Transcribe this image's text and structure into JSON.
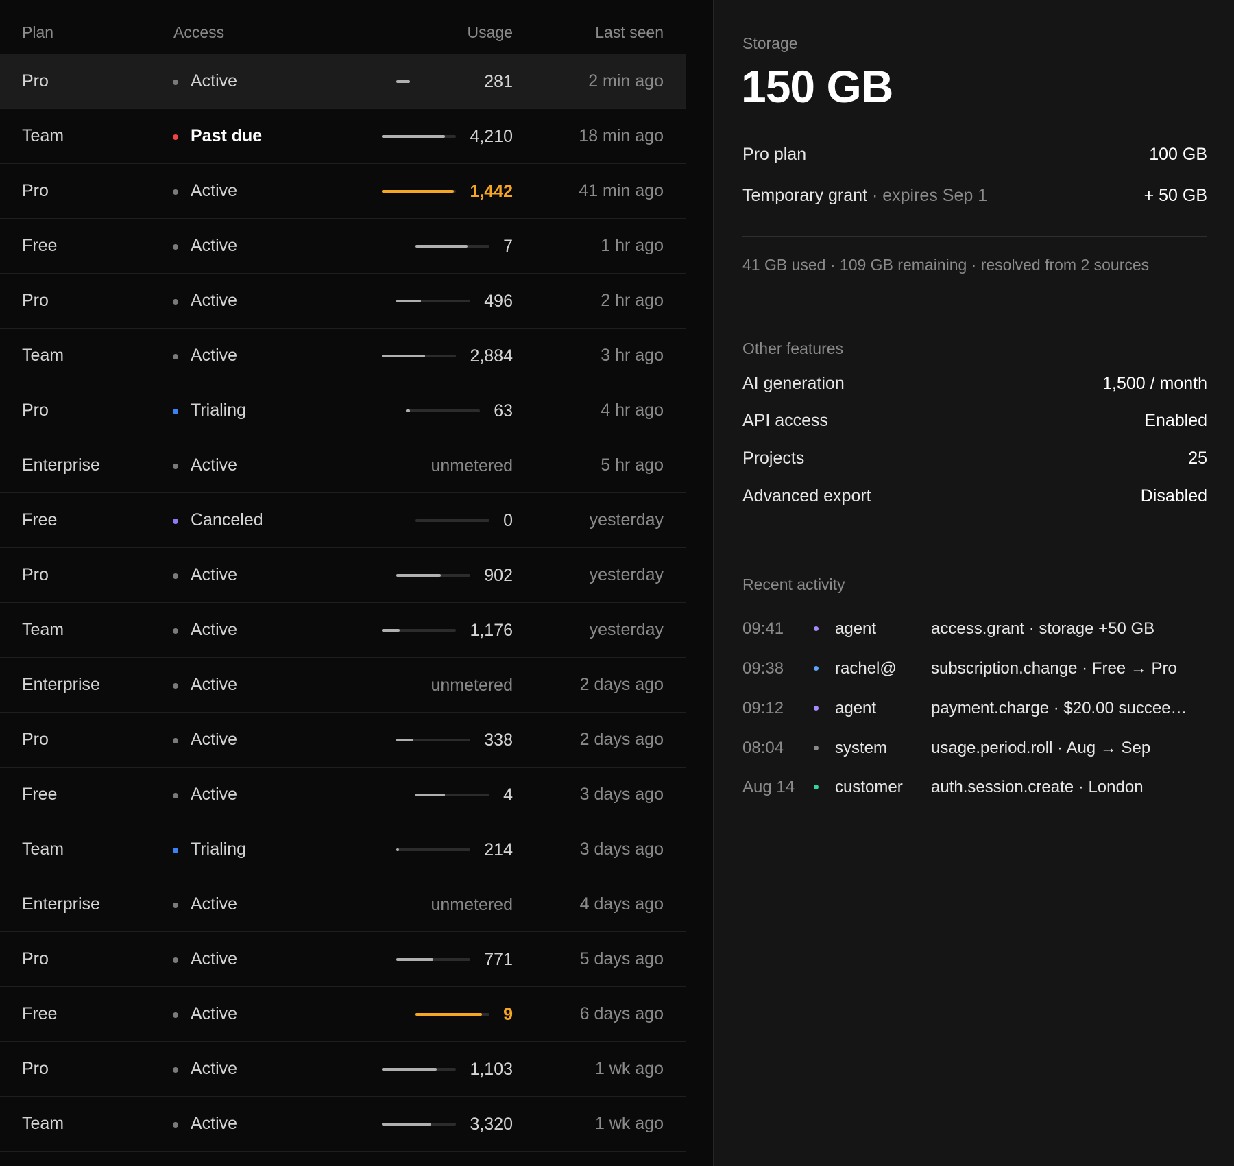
{
  "colors": {
    "active": "#7a7a7a",
    "past_due": "#ef4444",
    "trialing": "#3b82f6",
    "canceled": "#8b7cf6",
    "warn": "#f5a623",
    "agent": "#a78bfa",
    "user": "#60a5fa",
    "system": "#8a8a8a",
    "customer": "#34d399"
  },
  "table": {
    "headers": {
      "plan": "Plan",
      "access": "Access",
      "usage": "Usage",
      "last_seen": "Last seen"
    },
    "rows": [
      {
        "plan": "Pro",
        "access": "Active",
        "status": "active",
        "usage": "281",
        "fill": 0.0,
        "warn": false,
        "last_seen": "2 min ago",
        "selected": true
      },
      {
        "plan": "Team",
        "access": "Past due",
        "status": "past_due",
        "usage": "4,210",
        "fill": 0.85,
        "warn": false,
        "last_seen": "18 min ago"
      },
      {
        "plan": "Pro",
        "access": "Active",
        "status": "active",
        "usage": "1,442",
        "fill": 0.97,
        "warn": true,
        "last_seen": "41 min ago"
      },
      {
        "plan": "Free",
        "access": "Active",
        "status": "active",
        "usage": "7",
        "fill": 0.7,
        "warn": false,
        "last_seen": "1 hr ago"
      },
      {
        "plan": "Pro",
        "access": "Active",
        "status": "active",
        "usage": "496",
        "fill": 0.33,
        "warn": false,
        "last_seen": "2 hr ago"
      },
      {
        "plan": "Team",
        "access": "Active",
        "status": "active",
        "usage": "2,884",
        "fill": 0.58,
        "warn": false,
        "last_seen": "3 hr ago"
      },
      {
        "plan": "Pro",
        "access": "Trialing",
        "status": "trialing",
        "usage": "63",
        "fill": 0.06,
        "warn": false,
        "last_seen": "4 hr ago"
      },
      {
        "plan": "Enterprise",
        "access": "Active",
        "status": "active",
        "usage": "unmetered",
        "fill": null,
        "warn": false,
        "last_seen": "5 hr ago"
      },
      {
        "plan": "Free",
        "access": "Canceled",
        "status": "canceled",
        "usage": "0",
        "fill": 0.0,
        "warn": false,
        "last_seen": "yesterday"
      },
      {
        "plan": "Pro",
        "access": "Active",
        "status": "active",
        "usage": "902",
        "fill": 0.6,
        "warn": false,
        "last_seen": "yesterday"
      },
      {
        "plan": "Team",
        "access": "Active",
        "status": "active",
        "usage": "1,176",
        "fill": 0.24,
        "warn": false,
        "last_seen": "yesterday"
      },
      {
        "plan": "Enterprise",
        "access": "Active",
        "status": "active",
        "usage": "unmetered",
        "fill": null,
        "warn": false,
        "last_seen": "2 days ago"
      },
      {
        "plan": "Pro",
        "access": "Active",
        "status": "active",
        "usage": "338",
        "fill": 0.23,
        "warn": false,
        "last_seen": "2 days ago"
      },
      {
        "plan": "Free",
        "access": "Active",
        "status": "active",
        "usage": "4",
        "fill": 0.4,
        "warn": false,
        "last_seen": "3 days ago"
      },
      {
        "plan": "Team",
        "access": "Trialing",
        "status": "trialing",
        "usage": "214",
        "fill": 0.04,
        "warn": false,
        "last_seen": "3 days ago"
      },
      {
        "plan": "Enterprise",
        "access": "Active",
        "status": "active",
        "usage": "unmetered",
        "fill": null,
        "warn": false,
        "last_seen": "4 days ago"
      },
      {
        "plan": "Pro",
        "access": "Active",
        "status": "active",
        "usage": "771",
        "fill": 0.5,
        "warn": false,
        "last_seen": "5 days ago"
      },
      {
        "plan": "Free",
        "access": "Active",
        "status": "active",
        "usage": "9",
        "fill": 0.9,
        "warn": true,
        "last_seen": "6 days ago"
      },
      {
        "plan": "Pro",
        "access": "Active",
        "status": "active",
        "usage": "1,103",
        "fill": 0.74,
        "warn": false,
        "last_seen": "1 wk ago"
      },
      {
        "plan": "Team",
        "access": "Active",
        "status": "active",
        "usage": "3,320",
        "fill": 0.67,
        "warn": false,
        "last_seen": "1 wk ago"
      }
    ]
  },
  "storage": {
    "label": "Storage",
    "total": "150 GB",
    "sources": [
      {
        "name": "Pro plan",
        "note": "",
        "value": "100 GB"
      },
      {
        "name": "Temporary grant",
        "note": " · expires Sep 1",
        "value": "+ 50 GB"
      }
    ],
    "summary": "41 GB used · 109 GB remaining · resolved from 2 sources"
  },
  "features": {
    "label": "Other features",
    "items": [
      {
        "name": "AI generation",
        "value": "1,500 / month"
      },
      {
        "name": "API access",
        "value": "Enabled"
      },
      {
        "name": "Projects",
        "value": "25"
      },
      {
        "name": "Advanced export",
        "value": "Disabled"
      }
    ]
  },
  "activity": {
    "label": "Recent activity",
    "items": [
      {
        "time": "09:41",
        "actor": "agent",
        "actor_type": "agent",
        "event": "access.grant · storage +50 GB"
      },
      {
        "time": "09:38",
        "actor": "rachel@",
        "actor_type": "user",
        "event": "subscription.change · Free → Pro"
      },
      {
        "time": "09:12",
        "actor": "agent",
        "actor_type": "agent",
        "event": "payment.charge · $20.00 succee…"
      },
      {
        "time": "08:04",
        "actor": "system",
        "actor_type": "system",
        "event": "usage.period.roll · Aug → Sep"
      },
      {
        "time": "Aug 14",
        "actor": "customer",
        "actor_type": "customer",
        "event": "auth.session.create · London"
      }
    ]
  }
}
